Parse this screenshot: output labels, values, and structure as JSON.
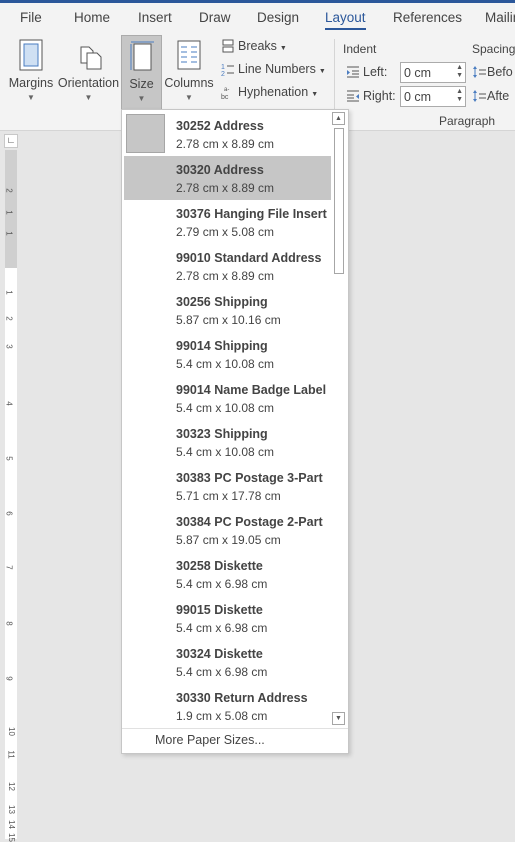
{
  "tabs": [
    "File",
    "Home",
    "Insert",
    "Draw",
    "Design",
    "Layout",
    "References",
    "Mailin"
  ],
  "active_tab": "Layout",
  "ribbon": {
    "margins": "Margins",
    "orientation": "Orientation",
    "size": "Size",
    "columns": "Columns",
    "breaks": "Breaks",
    "line_numbers": "Line Numbers",
    "hyphenation": "Hyphenation",
    "indent_title": "Indent",
    "spacing_title": "Spacing",
    "left_label": "Left:",
    "right_label": "Right:",
    "left_value": "0 cm",
    "right_value": "0 cm",
    "before_label": "Befo",
    "after_label": "Afte",
    "paragraph_group": "Paragraph"
  },
  "dropdown": {
    "items": [
      {
        "name": "30252 Address",
        "dims": "2.78 cm x 8.89 cm"
      },
      {
        "name": "30320 Address",
        "dims": "2.78 cm x 8.89 cm"
      },
      {
        "name": "30376 Hanging File Insert",
        "dims": "2.79 cm x 5.08 cm"
      },
      {
        "name": "99010 Standard Address",
        "dims": "2.78 cm x 8.89 cm"
      },
      {
        "name": "30256 Shipping",
        "dims": "5.87 cm x 10.16 cm"
      },
      {
        "name": "99014 Shipping",
        "dims": "5.4 cm x 10.08 cm"
      },
      {
        "name": "99014 Name Badge Label",
        "dims": "5.4 cm x 10.08 cm"
      },
      {
        "name": "30323 Shipping",
        "dims": "5.4 cm x 10.08 cm"
      },
      {
        "name": "30383 PC Postage 3-Part",
        "dims": "5.71 cm x 17.78 cm"
      },
      {
        "name": "30384 PC Postage 2-Part",
        "dims": "5.87 cm x 19.05 cm"
      },
      {
        "name": "30258 Diskette",
        "dims": "5.4 cm x 6.98 cm"
      },
      {
        "name": "99015 Diskette",
        "dims": "5.4 cm x 6.98 cm"
      },
      {
        "name": "30324 Diskette",
        "dims": "5.4 cm x 6.98 cm"
      },
      {
        "name": "30330 Return Address",
        "dims": "1.9 cm x 5.08 cm"
      }
    ],
    "selected_index": 1,
    "more_label": "More Paper Sizes..."
  },
  "ruler_numbers": [
    "2",
    "1",
    "1",
    "1",
    "2",
    "3",
    "4",
    "5",
    "6",
    "7",
    "8",
    "9",
    "10",
    "11",
    "12",
    "13",
    "14",
    "15"
  ],
  "colors": {
    "accent": "#2b579a",
    "selected": "#c6c6c6",
    "ribbon_bg": "#f3f3f3",
    "canvas_bg": "#e6e6e6"
  }
}
